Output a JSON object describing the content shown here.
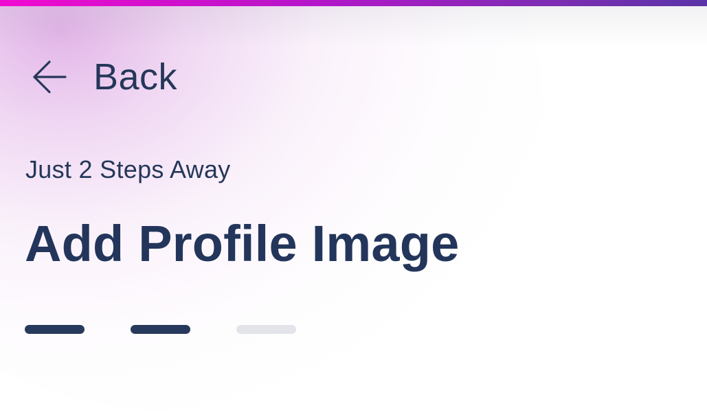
{
  "header": {
    "back_label": "Back",
    "back_icon": "arrow-left-icon"
  },
  "content": {
    "subtitle": "Just 2 Steps Away",
    "title": "Add Profile Image"
  },
  "progress": {
    "total_steps": 3,
    "completed_steps": 2
  },
  "colors": {
    "text_primary": "#253759",
    "step_active": "#273a5c",
    "step_inactive": "#e2e4e9",
    "top_bar_start": "#f10ad0",
    "top_bar_end": "#5a33a8"
  }
}
